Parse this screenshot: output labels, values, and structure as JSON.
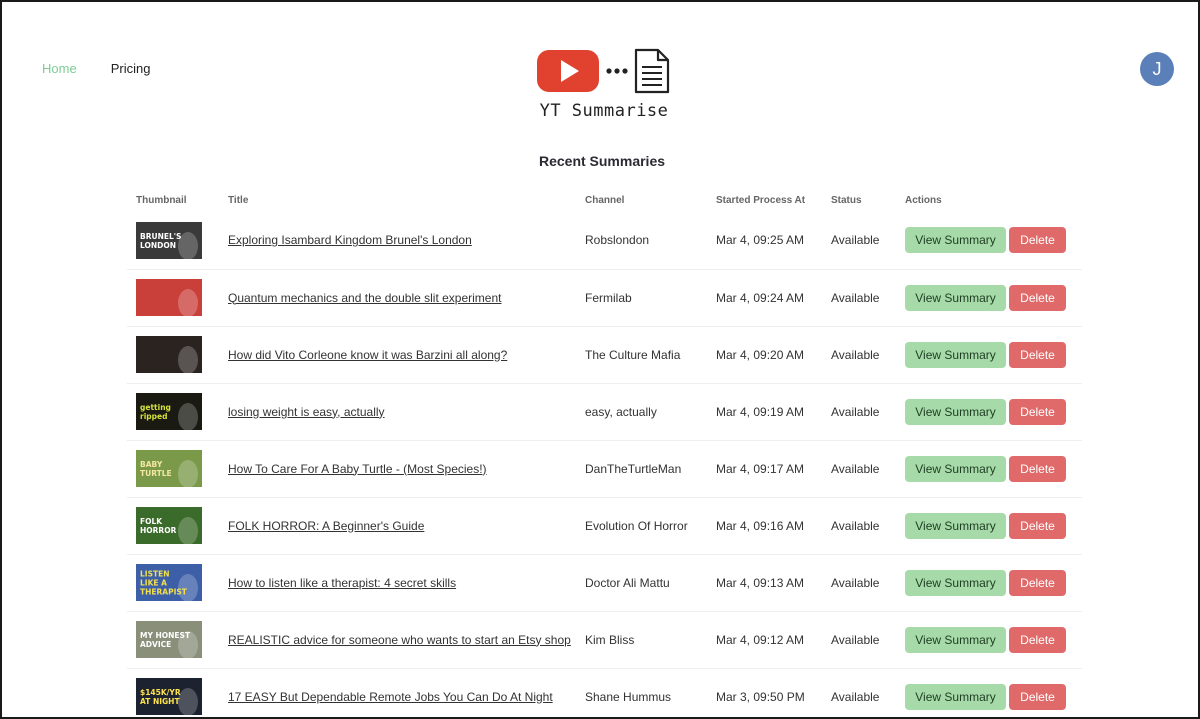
{
  "nav": {
    "home": "Home",
    "pricing": "Pricing"
  },
  "logo": {
    "text": "YT Summarise"
  },
  "user": {
    "initial": "J"
  },
  "section_title": "Recent Summaries",
  "table": {
    "headers": [
      "Thumbnail",
      "Title",
      "Channel",
      "Started Process At",
      "Status",
      "Actions"
    ],
    "view_label": "View Summary",
    "delete_label": "Delete",
    "rows": [
      {
        "title": "Exploring Isambard Kingdom Brunel's London",
        "channel": "Robslondon",
        "started": "Mar 4, 09:25 AM",
        "status": "Available",
        "thumb_text": "BRUNEL'S LONDON",
        "thumb_bg": "#3a3a3a",
        "thumb_fg": "#ffffff"
      },
      {
        "title": "Quantum mechanics and the double slit experiment",
        "channel": "Fermilab",
        "started": "Mar 4, 09:24 AM",
        "status": "Available",
        "thumb_text": "",
        "thumb_bg": "#c9403b",
        "thumb_fg": "#ffffff"
      },
      {
        "title": "How did Vito Corleone know it was Barzini all along?",
        "channel": "The Culture Mafia",
        "started": "Mar 4, 09:20 AM",
        "status": "Available",
        "thumb_text": "",
        "thumb_bg": "#2b2320",
        "thumb_fg": "#ffffff"
      },
      {
        "title": "losing weight is easy, actually",
        "channel": "easy, actually",
        "started": "Mar 4, 09:19 AM",
        "status": "Available",
        "thumb_text": "getting ripped",
        "thumb_bg": "#1a1a12",
        "thumb_fg": "#d6e23a"
      },
      {
        "title": "How To Care For A Baby Turtle - (Most Species!)",
        "channel": "DanTheTurtleMan",
        "started": "Mar 4, 09:17 AM",
        "status": "Available",
        "thumb_text": "BABY TURTLE",
        "thumb_bg": "#7a9a4a",
        "thumb_fg": "#f3e7a0"
      },
      {
        "title": "FOLK HORROR: A Beginner's Guide",
        "channel": "Evolution Of Horror",
        "started": "Mar 4, 09:16 AM",
        "status": "Available",
        "thumb_text": "FOLK HORROR",
        "thumb_bg": "#3b6b2a",
        "thumb_fg": "#ffffff"
      },
      {
        "title": "How to listen like a therapist: 4 secret skills",
        "channel": "Doctor Ali Mattu",
        "started": "Mar 4, 09:13 AM",
        "status": "Available",
        "thumb_text": "LISTEN LIKE A THERAPIST",
        "thumb_bg": "#3d5fa8",
        "thumb_fg": "#f4e04a"
      },
      {
        "title": "REALISTIC advice for someone who wants to start an Etsy shop",
        "channel": "Kim Bliss",
        "started": "Mar 4, 09:12 AM",
        "status": "Available",
        "thumb_text": "MY HONEST ADVICE",
        "thumb_bg": "#8a8f7a",
        "thumb_fg": "#ffffff"
      },
      {
        "title": "17 EASY But Dependable Remote Jobs You Can Do At Night",
        "channel": "Shane Hummus",
        "started": "Mar 3, 09:50 PM",
        "status": "Available",
        "thumb_text": "$145K/YR AT NIGHT",
        "thumb_bg": "#1c2230",
        "thumb_fg": "#ffe34d"
      }
    ]
  },
  "colors": {
    "accent": "#7ccc94",
    "view_button": "#a6dba9",
    "delete_button": "#e06a6a",
    "avatar": "#5b7fb8",
    "logo_red": "#e1412f"
  },
  "icons": {
    "logo_play": "play-icon",
    "logo_dots": "ellipsis-icon",
    "logo_doc": "document-icon"
  }
}
